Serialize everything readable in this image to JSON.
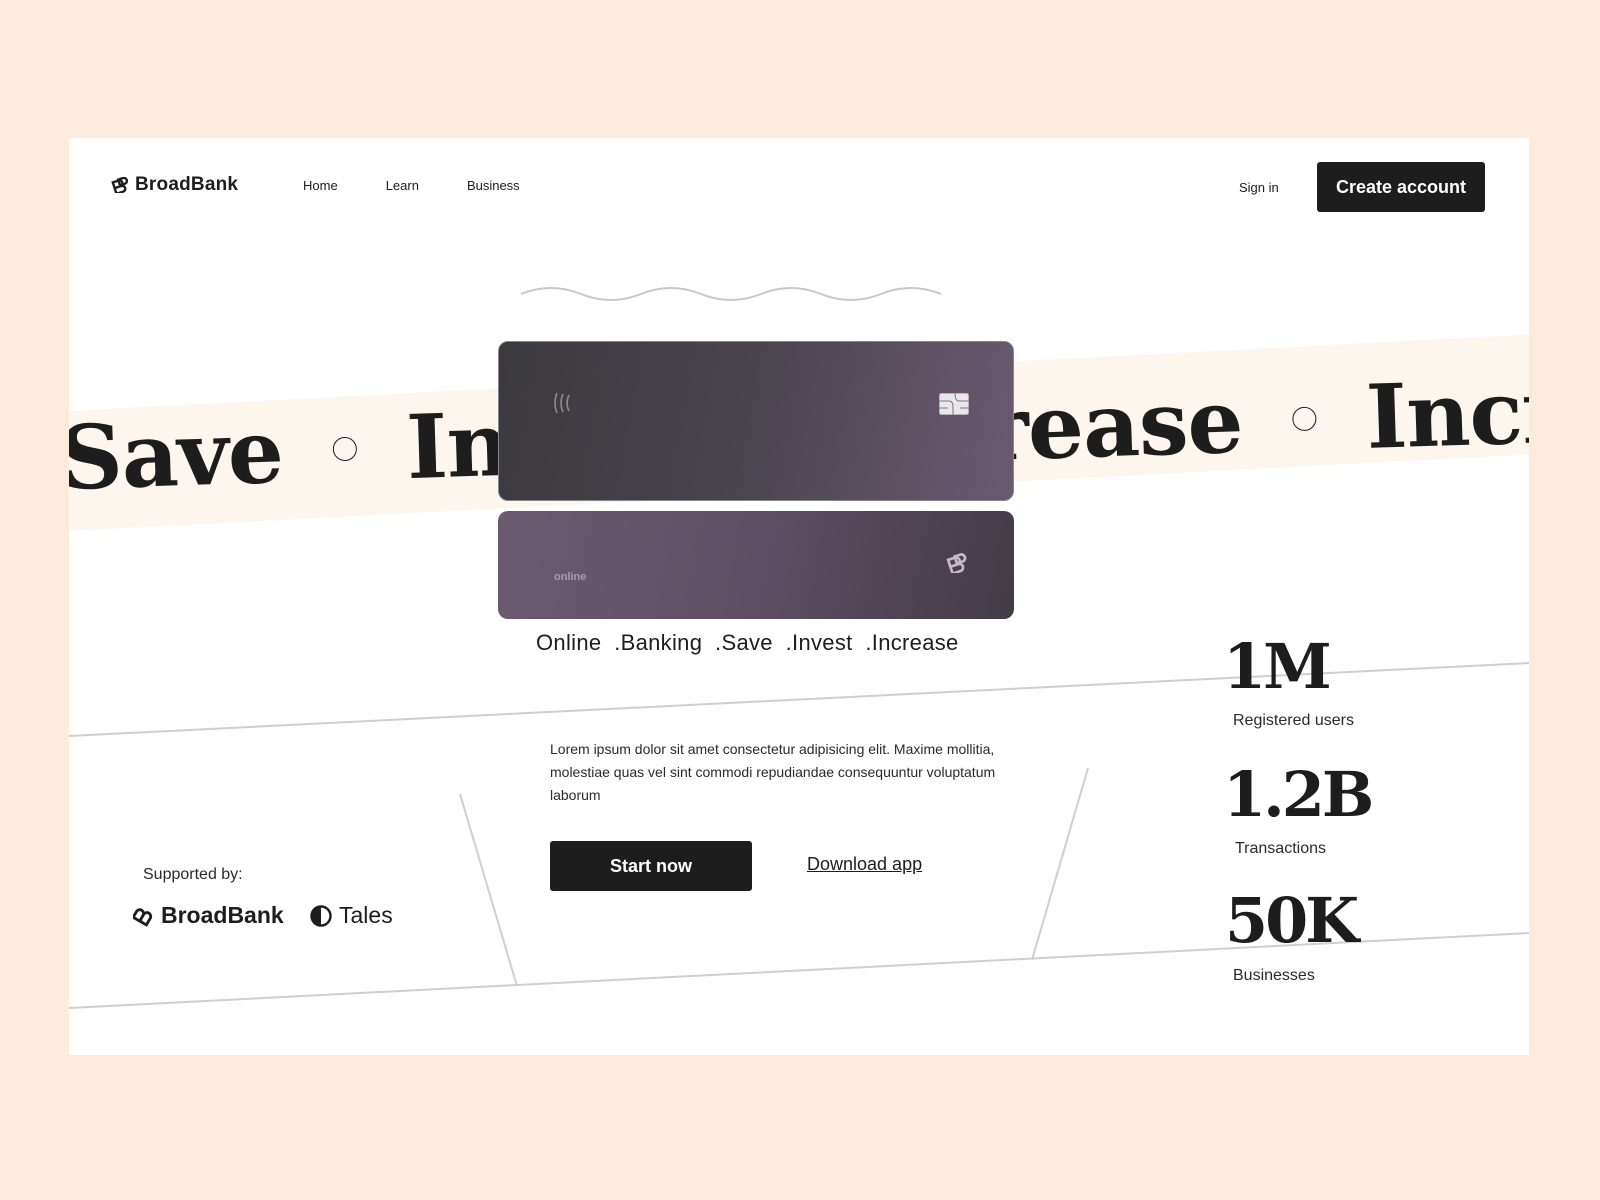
{
  "header": {
    "brand": "BroadBank",
    "nav": [
      "Home",
      "Learn",
      "Business"
    ],
    "sign_in": "Sign in",
    "create_account": "Create account"
  },
  "hero": {
    "marquee": [
      "Save",
      "Invest",
      "Increase",
      "Increa"
    ],
    "card_label": "online",
    "tagline": "Online  .Banking  .Save  .Invest  .Increase"
  },
  "content": {
    "lorem": "Lorem ipsum dolor sit amet consectetur adipisicing elit. Maxime mollitia, molestiae quas vel sint commodi repudiandae consequuntur voluptatum laborum",
    "start_now": "Start now",
    "download_app": "Download app"
  },
  "supported": {
    "label": "Supported by:",
    "brands": [
      "BroadBank",
      "Tales"
    ]
  },
  "stats": [
    {
      "value": "1M",
      "label": "Registered users"
    },
    {
      "value": "1.2B",
      "label": "Transactions"
    },
    {
      "value": "50K",
      "label": "Businesses"
    }
  ],
  "colors": {
    "page_bg": "#fcebdc",
    "frame_bg": "#ffffff",
    "ink": "#1d1d1d",
    "card_dark": "#3b3a3e",
    "card_purple": "#6a5a70"
  }
}
